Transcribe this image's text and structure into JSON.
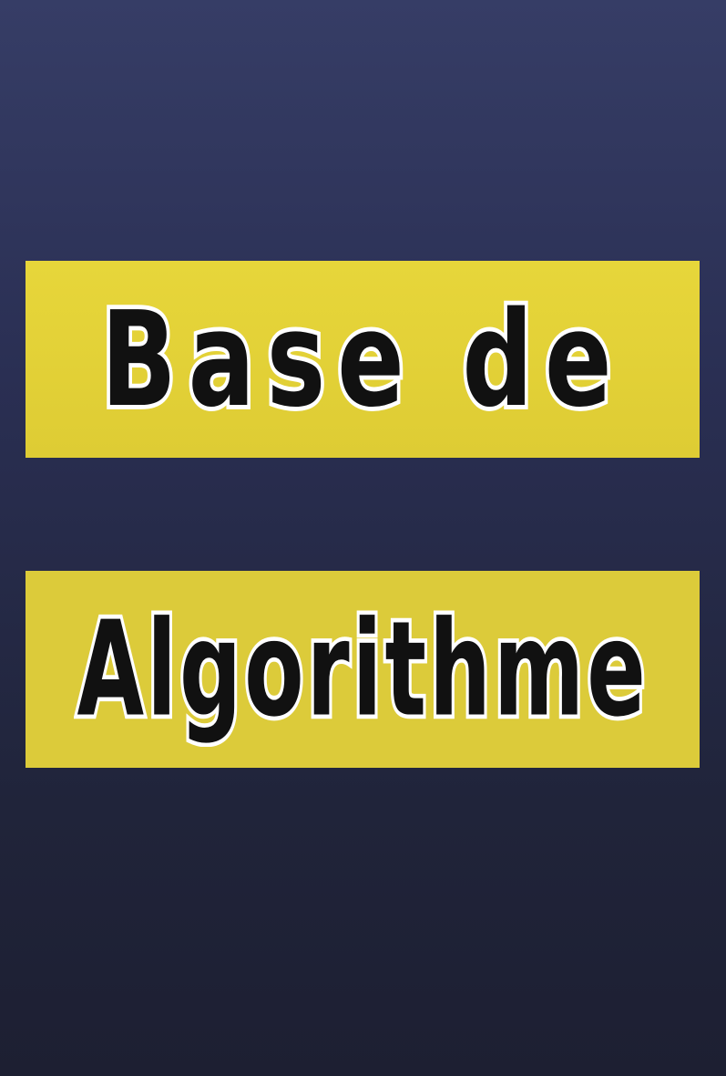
{
  "cover": {
    "line1": "Base de",
    "line2": "Algorithme",
    "colors": {
      "background_top": "#363d66",
      "background_bottom": "#1d1f32",
      "band": "#e2d238",
      "text": "#111111",
      "text_outline": "#ffffff"
    }
  }
}
